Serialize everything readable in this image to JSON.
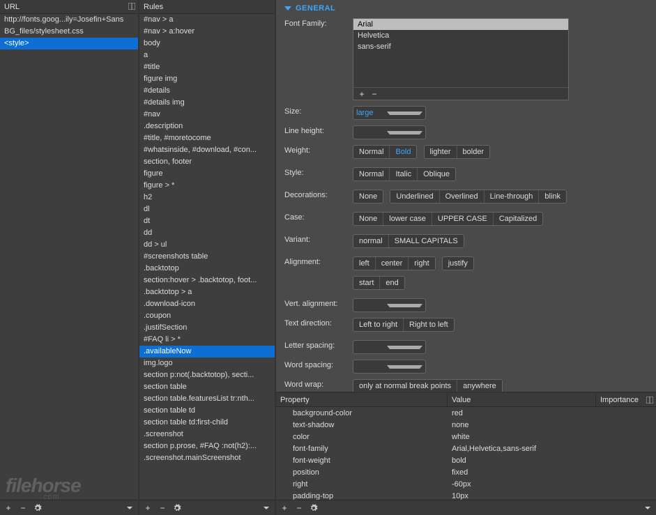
{
  "url_panel": {
    "header": "URL",
    "items": [
      "http://fonts.goog...ily=Josefin+Sans",
      "BG_files/stylesheet.css",
      "<style>"
    ],
    "selected_index": 2
  },
  "rules_panel": {
    "header": "Rules",
    "items": [
      "#nav > a",
      "#nav > a:hover",
      "body",
      "a",
      "#title",
      "figure img",
      "#details",
      "#details img",
      "#nav",
      ".description",
      "#title, #moretocome",
      "#whatsinside, #download, #con...",
      "section, footer",
      "figure",
      "figure > *",
      "h2",
      "dl",
      "dt",
      "dd",
      "dd > ul",
      "#screenshots table",
      ".backtotop",
      "section:hover > .backtotop, foot...",
      ".backtotop > a",
      ".download-icon",
      ".coupon",
      ".justifSection",
      "#FAQ li > *",
      ".availableNow",
      "img.logo",
      "section p:not(.backtotop), secti...",
      "section table",
      "section table.featuresList tr:nth...",
      "section table td",
      "section table td:first-child",
      ".screenshot",
      "section p.prose, #FAQ :not(h2):...",
      ".screenshot.mainScreenshot"
    ],
    "selected_index": 28
  },
  "general": {
    "title": "GENERAL",
    "font_family_label": "Font Family:",
    "fonts": [
      "Arial",
      "Helvetica",
      "sans-serif"
    ],
    "font_selected_index": 0,
    "size_label": "Size:",
    "size_value": "large",
    "line_height_label": "Line height:",
    "weight_label": "Weight:",
    "weight_opts_a": [
      "Normal",
      "Bold"
    ],
    "weight_active_a": 1,
    "weight_opts_b": [
      "lighter",
      "bolder"
    ],
    "style_label": "Style:",
    "style_opts": [
      "Normal",
      "Italic",
      "Oblique"
    ],
    "decorations_label": "Decorations:",
    "dec_none": "None",
    "dec_opts": [
      "Underlined",
      "Overlined",
      "Line-through",
      "blink"
    ],
    "case_label": "Case:",
    "case_opts": [
      "None",
      "lower case",
      "UPPER CASE",
      "Capitalized"
    ],
    "variant_label": "Variant:",
    "variant_opts": [
      "normal",
      "SMALL CAPITALS"
    ],
    "alignment_label": "Alignment:",
    "align_a": [
      "left",
      "center",
      "right"
    ],
    "align_justify": "justify",
    "align_b": [
      "start",
      "end"
    ],
    "valign_label": "Vert. alignment:",
    "textdir_label": "Text direction:",
    "textdir_opts": [
      "Left to right",
      "Right to left"
    ],
    "letterspacing_label": "Letter spacing:",
    "wordspacing_label": "Word spacing:",
    "wordwrap_label": "Word wrap:",
    "wordwrap_a": "only at normal break points",
    "wordwrap_b": "anywhere"
  },
  "props": {
    "header_property": "Property",
    "header_value": "Value",
    "header_importance": "Importance",
    "rows": [
      {
        "name": "background-color",
        "value": "red"
      },
      {
        "name": "text-shadow",
        "value": "none"
      },
      {
        "name": "color",
        "value": "white"
      },
      {
        "name": "font-family",
        "value": "Arial,Helvetica,sans-serif"
      },
      {
        "name": "font-weight",
        "value": "bold"
      },
      {
        "name": "position",
        "value": "fixed"
      },
      {
        "name": "right",
        "value": "-60px"
      },
      {
        "name": "padding-top",
        "value": "10px"
      }
    ]
  },
  "icons": {
    "plus": "+",
    "minus": "−",
    "gear": "✱"
  },
  "watermark": {
    "main": "filehorse",
    "sub": ".com"
  }
}
